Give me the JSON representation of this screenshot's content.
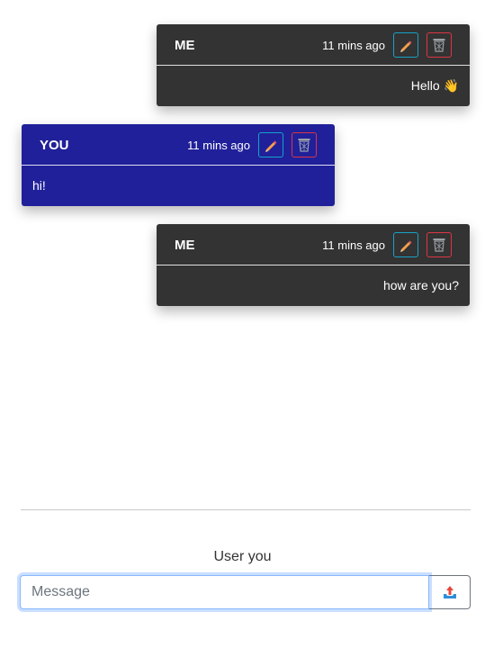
{
  "messages": [
    {
      "sender": "ME",
      "time": "11 mins ago",
      "text": "Hello 👋"
    },
    {
      "sender": "YOU",
      "time": "11 mins ago",
      "text": "hi!"
    },
    {
      "sender": "ME",
      "time": "11 mins ago",
      "text": "how are you?"
    }
  ],
  "footer": {
    "user_label": "User you",
    "input_placeholder": "Message",
    "input_value": ""
  },
  "icons": {
    "edit": "pencil-icon",
    "delete": "trash-icon",
    "send": "send-icon"
  },
  "colors": {
    "me_bg": "#333333",
    "you_bg": "#20209a",
    "edit_border": "#17a2c8",
    "delete_border": "#dc3545"
  }
}
